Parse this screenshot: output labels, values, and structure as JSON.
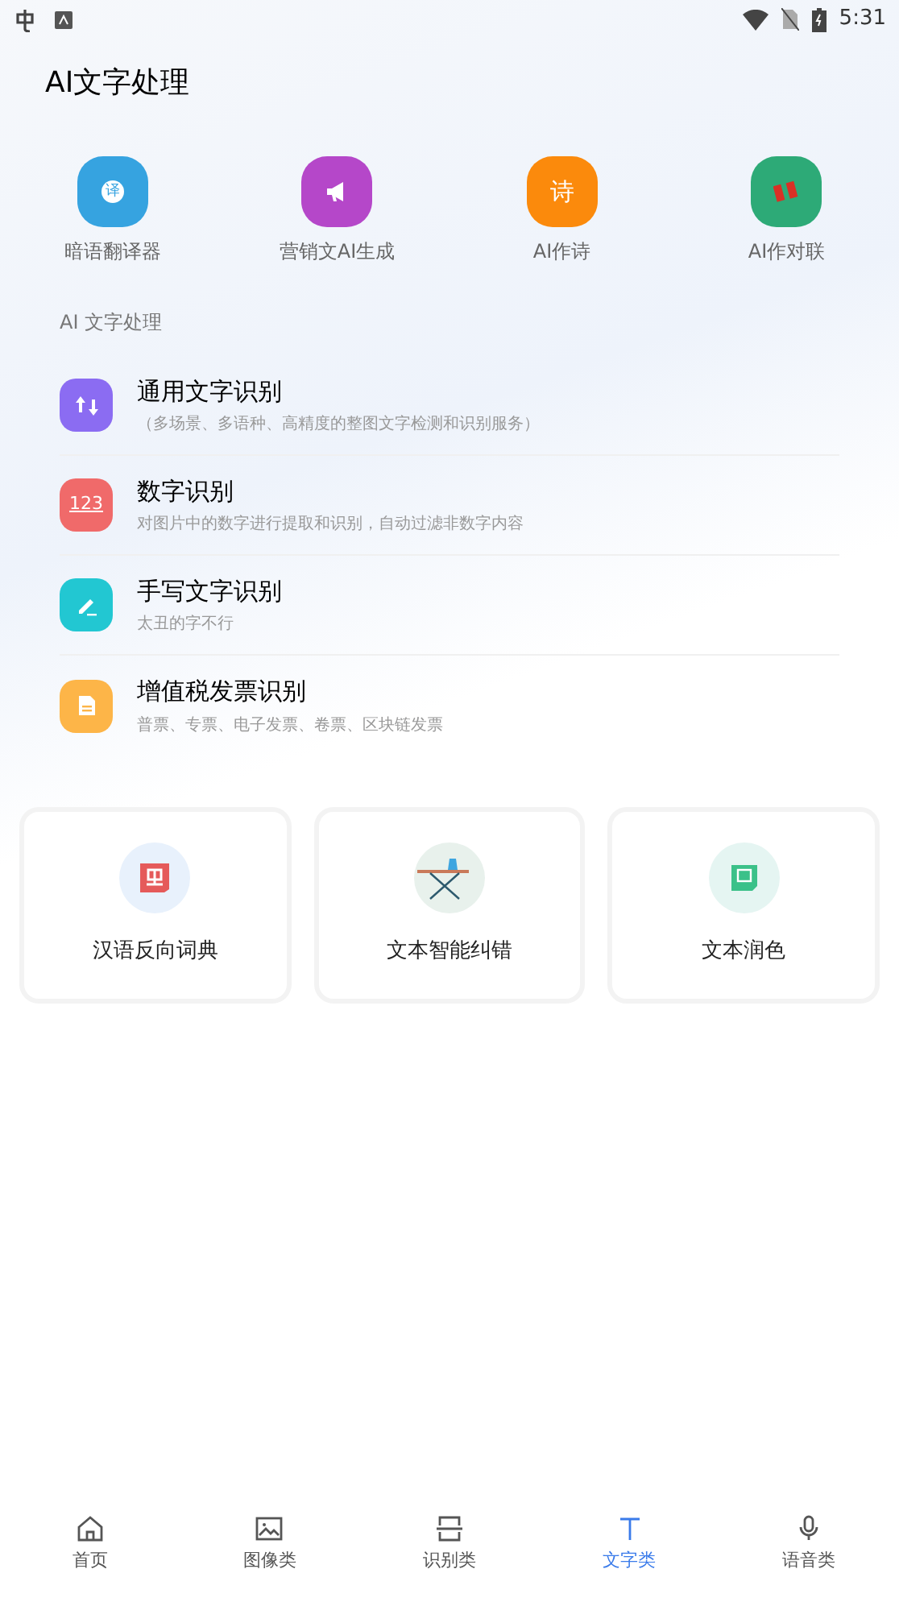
{
  "status_bar": {
    "time": "5:31"
  },
  "title": "AI文字处理",
  "quick_tools": [
    {
      "label": "暗语翻译器",
      "kind": "translate",
      "glyph": "译",
      "color": "#36a3e0"
    },
    {
      "label": "营销文AI生成",
      "kind": "megaphone",
      "color": "#b547c9"
    },
    {
      "label": "AI作诗",
      "kind": "glyph",
      "glyph": "诗",
      "color": "#fb8a0c"
    },
    {
      "label": "AI作对联",
      "kind": "couplet",
      "color": "#2daa77"
    }
  ],
  "section_title": "AI 文字处理",
  "ocr_items": [
    {
      "title": "通用文字识别",
      "subtitle": "（多场景、多语种、高精度的整图文字检测和识别服务）",
      "kind": "arrows",
      "color": "#8b6cf2"
    },
    {
      "title": "数字识别",
      "subtitle": "对图片中的数字进行提取和识别，自动过滤非数字内容",
      "kind": "digits",
      "glyph": "123",
      "color": "#f06a6a"
    },
    {
      "title": "手写文字识别",
      "subtitle": "太丑的字不行",
      "kind": "pen",
      "color": "#22c7d2"
    },
    {
      "title": "增值税发票识别",
      "subtitle": "普票、专票、电子发票、卷票、区块链发票",
      "kind": "doc",
      "color": "#fdb548"
    }
  ],
  "cards": [
    {
      "label": "汉语反向词典",
      "kind": "book",
      "color": "#e8f1fc"
    },
    {
      "label": "文本智能纠错",
      "kind": "ironing",
      "color": "#e8f1ec"
    },
    {
      "label": "文本润色",
      "kind": "note",
      "color": "#e5f5f2"
    }
  ],
  "tabs": [
    {
      "label": "首页",
      "kind": "home",
      "selected": false
    },
    {
      "label": "图像类",
      "kind": "image",
      "selected": false
    },
    {
      "label": "识别类",
      "kind": "scan",
      "selected": false
    },
    {
      "label": "文字类",
      "kind": "text",
      "selected": true
    },
    {
      "label": "语音类",
      "kind": "voice",
      "selected": false
    }
  ]
}
